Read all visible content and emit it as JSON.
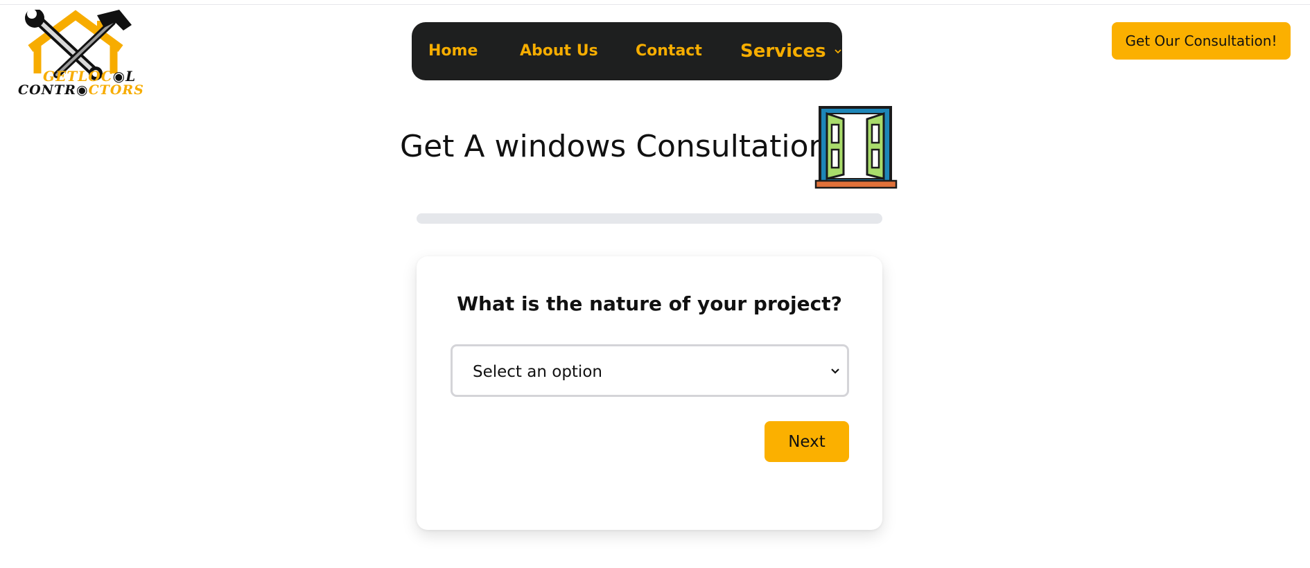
{
  "brand": {
    "logo_line1_yellow": "GETLOC",
    "logo_line1_black": "L",
    "logo_line2_black": "CONTR",
    "logo_line2_yellow": "CTORS",
    "accent_color": "#fbb000",
    "nav_bg_color": "#1e1f1f"
  },
  "nav": {
    "home": "Home",
    "about": "About Us",
    "contact": "Contact",
    "services": "Services",
    "services_icon": "chevron-down-icon"
  },
  "header": {
    "cta_label": "Get Our Consultation!"
  },
  "main": {
    "heading": "Get A windows Consultation!",
    "heading_icon": "window-icon",
    "progress_percent": 0
  },
  "form": {
    "question": "What is the nature of your project?",
    "select_value": "Select an option",
    "next_label": "Next"
  }
}
